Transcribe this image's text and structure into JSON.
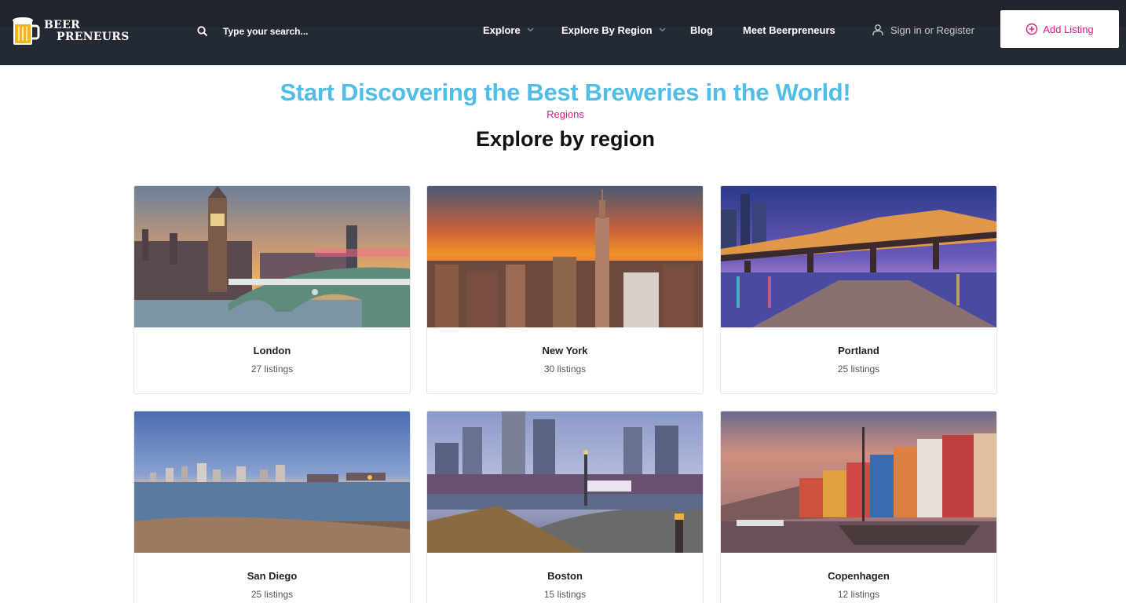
{
  "brand": {
    "line1": "BEER",
    "line2": "PRENEURS",
    "accent": "#f5b31c"
  },
  "search": {
    "placeholder": "Type your search..."
  },
  "nav": {
    "explore": "Explore",
    "explore_by_region": "Explore By Region",
    "blog": "Blog",
    "meet": "Meet Beerpreneurs",
    "signin": "Sign in or Register",
    "add_listing": "Add Listing"
  },
  "hero": {
    "title": "Start Discovering the Best Breweries in the World!"
  },
  "section": {
    "eyebrow": "Regions",
    "title": "Explore by region"
  },
  "regions": [
    {
      "name": "London",
      "count": "27 listings"
    },
    {
      "name": "New York",
      "count": "30 listings"
    },
    {
      "name": "Portland",
      "count": "25 listings"
    },
    {
      "name": "San Diego",
      "count": "25 listings"
    },
    {
      "name": "Boston",
      "count": "15 listings"
    },
    {
      "name": "Copenhagen",
      "count": "12 listings"
    }
  ],
  "colors": {
    "header": "#242a33",
    "title": "#4fbde6",
    "pink": "#e5197a"
  },
  "icons": [
    "beer-mug-icon",
    "search-icon",
    "chevron-down-icon",
    "user-icon",
    "plus-circle-icon"
  ]
}
